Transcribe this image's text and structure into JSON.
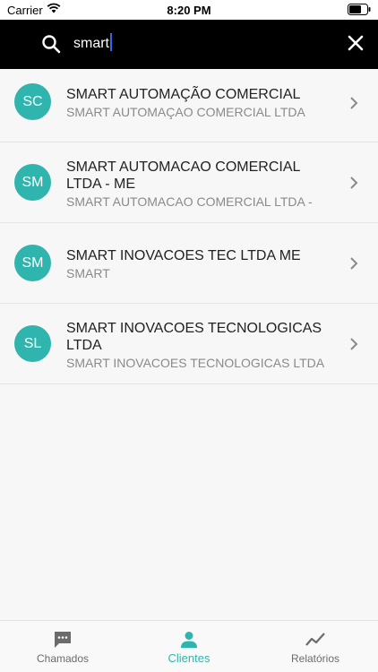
{
  "status_bar": {
    "carrier": "Carrier",
    "time": "8:20 PM"
  },
  "search": {
    "value": "smart",
    "icon": "search-icon",
    "close_icon": "close-icon"
  },
  "results": [
    {
      "initials": "SC",
      "title_line1": "SMART AUTOMAÇÃO COMERCIAL",
      "title_line2": "",
      "subtitle": "SMART AUTOMAÇAO COMERCIAL LTDA"
    },
    {
      "initials": "SM",
      "title_line1": "SMART AUTOMACAO COMERCIAL",
      "title_line2": "LTDA - ME",
      "subtitle": "SMART AUTOMACAO COMERCIAL LTDA -"
    },
    {
      "initials": "SM",
      "title_line1": "SMART INOVACOES TEC LTDA ME",
      "title_line2": "",
      "subtitle": "SMART"
    },
    {
      "initials": "SL",
      "title_line1": "SMART INOVACOES TECNOLOGICAS",
      "title_line2": "LTDA",
      "subtitle": "SMART INOVACOES TECNOLOGICAS LTDA"
    }
  ],
  "tabs": [
    {
      "label": "Chamados",
      "icon": "chat-bubble-icon",
      "active": false
    },
    {
      "label": "Clientes",
      "icon": "person-icon",
      "active": true
    },
    {
      "label": "Relatórios",
      "icon": "trending-line-icon",
      "active": false
    }
  ],
  "colors": {
    "accent": "#2fb5ad",
    "header_bg": "#000000",
    "inactive_tab": "#6b6b6b"
  }
}
